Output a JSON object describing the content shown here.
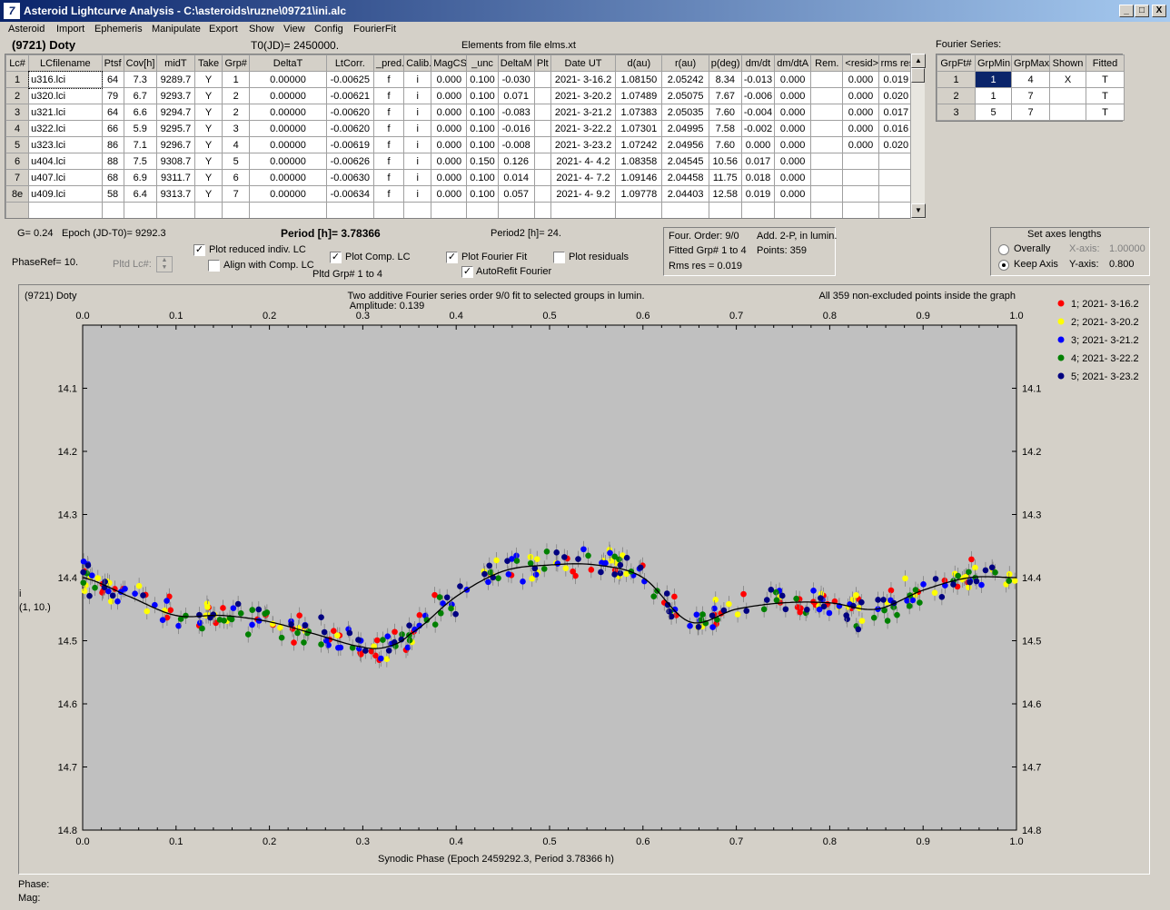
{
  "window": {
    "title": "Asteroid Lightcurve Analysis - C:\\asteroids\\ruzne\\09721\\ini.alc",
    "icon_name": "app-logo-icon",
    "minimize": "_",
    "maximize": "□",
    "close": "X"
  },
  "menu": [
    "Asteroid",
    "Import",
    "Ephemeris",
    "Manipulate",
    "Export",
    "Show",
    "View",
    "Config",
    "FourierFit"
  ],
  "header": {
    "asteroid": "(9721) Doty",
    "t0": "T0(JD)= 2450000.",
    "elements": "Elements from file elms.xt"
  },
  "lc_table": {
    "columns": [
      "Lc#",
      "LCfilename",
      "Ptsf",
      "Cov[h]",
      "midT",
      "Take",
      "Grp#",
      "DeltaT",
      "LtCorr.",
      "_pred.",
      "Calib.",
      "MagCS",
      "_unc",
      "DeltaM",
      "Plt",
      "Date UT",
      "d(au)",
      "r(au)",
      "p(deg)",
      "dm/dt",
      "dm/dtA",
      "Rem.",
      "<resid>",
      "rms res"
    ],
    "rows": [
      [
        "1",
        "u316.lci",
        "64",
        "7.3",
        "9289.7",
        "Y",
        "1",
        "0.00000",
        "-0.00625",
        "f",
        "i",
        "0.000",
        "0.100",
        "-0.030",
        "",
        "2021- 3-16.2",
        "1.08150",
        "2.05242",
        "8.34",
        "-0.013",
        "0.000",
        "",
        "0.000",
        "0.019"
      ],
      [
        "2",
        "u320.lci",
        "79",
        "6.7",
        "9293.7",
        "Y",
        "2",
        "0.00000",
        "-0.00621",
        "f",
        "i",
        "0.000",
        "0.100",
        "0.071",
        "",
        "2021- 3-20.2",
        "1.07489",
        "2.05075",
        "7.67",
        "-0.006",
        "0.000",
        "",
        "0.000",
        "0.020"
      ],
      [
        "3",
        "u321.lci",
        "64",
        "6.6",
        "9294.7",
        "Y",
        "2",
        "0.00000",
        "-0.00620",
        "f",
        "i",
        "0.000",
        "0.100",
        "-0.083",
        "",
        "2021- 3-21.2",
        "1.07383",
        "2.05035",
        "7.60",
        "-0.004",
        "0.000",
        "",
        "0.000",
        "0.017"
      ],
      [
        "4",
        "u322.lci",
        "66",
        "5.9",
        "9295.7",
        "Y",
        "3",
        "0.00000",
        "-0.00620",
        "f",
        "i",
        "0.000",
        "0.100",
        "-0.016",
        "",
        "2021- 3-22.2",
        "1.07301",
        "2.04995",
        "7.58",
        "-0.002",
        "0.000",
        "",
        "0.000",
        "0.016"
      ],
      [
        "5",
        "u323.lci",
        "86",
        "7.1",
        "9296.7",
        "Y",
        "4",
        "0.00000",
        "-0.00619",
        "f",
        "i",
        "0.000",
        "0.100",
        "-0.008",
        "",
        "2021- 3-23.2",
        "1.07242",
        "2.04956",
        "7.60",
        "0.000",
        "0.000",
        "",
        "0.000",
        "0.020"
      ],
      [
        "6",
        "u404.lci",
        "88",
        "7.5",
        "9308.7",
        "Y",
        "5",
        "0.00000",
        "-0.00626",
        "f",
        "i",
        "0.000",
        "0.150",
        "0.126",
        "",
        "2021- 4- 4.2",
        "1.08358",
        "2.04545",
        "10.56",
        "0.017",
        "0.000",
        "",
        "",
        ""
      ],
      [
        "7",
        "u407.lci",
        "68",
        "6.9",
        "9311.7",
        "Y",
        "6",
        "0.00000",
        "-0.00630",
        "f",
        "i",
        "0.000",
        "0.100",
        "0.014",
        "",
        "2021- 4- 7.2",
        "1.09146",
        "2.04458",
        "11.75",
        "0.018",
        "0.000",
        "",
        "",
        ""
      ],
      [
        "8e",
        "u409.lci",
        "58",
        "6.4",
        "9313.7",
        "Y",
        "7",
        "0.00000",
        "-0.00634",
        "f",
        "i",
        "0.000",
        "0.100",
        "0.057",
        "",
        "2021- 4- 9.2",
        "1.09778",
        "2.04403",
        "12.58",
        "0.019",
        "0.000",
        "",
        "",
        ""
      ]
    ]
  },
  "fourier_table": {
    "title": "Fourier Series:",
    "columns": [
      "GrpFt#",
      "GrpMin",
      "GrpMax",
      "Shown",
      "Fitted"
    ],
    "rows": [
      [
        "1",
        "1",
        "4",
        "X",
        "T"
      ],
      [
        "2",
        "1",
        "7",
        "",
        "T"
      ],
      [
        "3",
        "5",
        "7",
        "",
        "T"
      ]
    ]
  },
  "controls": {
    "g": "G= 0.24",
    "epoch": "Epoch (JD-T0)= 9292.3",
    "period": "Period [h]= 3.78366",
    "period2": "Period2 [h]= 24.",
    "phaseref": "PhaseRef= 10.",
    "pltd_lc": "Pltd Lc#:",
    "pltd_grp": "Pltd Grp#  1   to    4",
    "plot_reduced": "Plot reduced indiv. LC",
    "align": "Align with Comp. LC",
    "plot_comp": "Plot Comp. LC",
    "plot_fourier": "Plot Fourier Fit",
    "autorefit": "AutoRefit Fourier",
    "plot_residuals": "Plot residuals",
    "four_order": "Four. Order:  9/0",
    "add2p": "Add. 2-P, in lumin.",
    "fitted_grp": "Fitted Grp# 1 to 4",
    "points": "Points: 359",
    "rms": "Rms res      = 0.019",
    "axes_title": "Set axes lengths",
    "overally": "Overally",
    "keep_axis": "Keep Axis",
    "xaxis_lbl": "X-axis:",
    "xaxis_val": "1.00000",
    "yaxis_lbl": "Y-axis:",
    "yaxis_val": "0.800",
    "check": "✓"
  },
  "footer": {
    "phase": "Phase:",
    "mag": "Mag:"
  },
  "chart_data": {
    "type": "scatter",
    "title": "Two additive Fourier series order 9/0 fit to selected groups in lumin.",
    "subtitle": "Amplitude: 0.139",
    "top_left": "(9721) Doty",
    "top_right": "All 359 non-excluded points inside the graph",
    "xlabel": "Synodic Phase (Epoch 2459292.3, Period 3.78366 h)",
    "ylabel": "i",
    "ylabel2": "(1, 10.)",
    "xlim": [
      0.0,
      1.0
    ],
    "ylim": [
      14.0,
      14.8
    ],
    "y_inverted": true,
    "xticks": [
      "0.0",
      "0.1",
      "0.2",
      "0.3",
      "0.4",
      "0.5",
      "0.6",
      "0.7",
      "0.8",
      "0.9",
      "1.0"
    ],
    "yticks": [
      "14.1",
      "14.2",
      "14.3",
      "14.4",
      "14.5",
      "14.6",
      "14.7",
      "14.8"
    ],
    "legend": [
      {
        "name": "1; 2021- 3-16.2",
        "color": "#ff0000"
      },
      {
        "name": "2; 2021- 3-20.2",
        "color": "#ffff00"
      },
      {
        "name": "3; 2021- 3-21.2",
        "color": "#0000ff"
      },
      {
        "name": "4; 2021- 3-22.2",
        "color": "#008000"
      },
      {
        "name": "5; 2021- 3-23.2",
        "color": "#000080"
      }
    ],
    "fit_curve": {
      "x": [
        0.0,
        0.05,
        0.1,
        0.15,
        0.2,
        0.25,
        0.3,
        0.325,
        0.35,
        0.4,
        0.45,
        0.5,
        0.55,
        0.6,
        0.65,
        0.7,
        0.75,
        0.8,
        0.85,
        0.9,
        0.95,
        1.0
      ],
      "y": [
        14.4,
        14.43,
        14.46,
        14.46,
        14.47,
        14.49,
        14.51,
        14.51,
        14.49,
        14.43,
        14.39,
        14.38,
        14.38,
        14.4,
        14.47,
        14.45,
        14.44,
        14.44,
        14.45,
        14.42,
        14.4,
        14.4
      ]
    },
    "points_per_series": 70,
    "scatter_sigma": 0.022,
    "background": "#c0c0c0"
  }
}
